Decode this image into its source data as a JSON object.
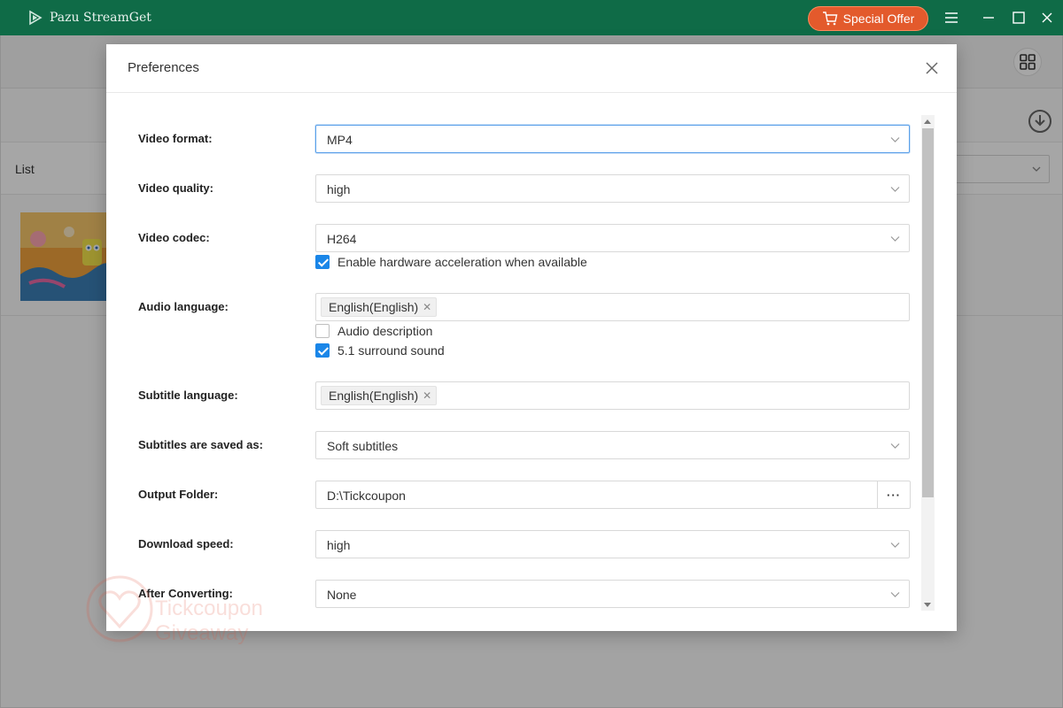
{
  "titlebar": {
    "app_name": "Pazu StreamGet",
    "special_offer_label": "Special Offer",
    "accent_color": "#0f6b47",
    "offer_color": "#e35a2c"
  },
  "background": {
    "list_label": "List"
  },
  "watermark": {
    "line1": "Tickcoupon",
    "line2": "Giveaway"
  },
  "dialog": {
    "title": "Preferences",
    "fields": {
      "video_format": {
        "label": "Video format:",
        "value": "MP4"
      },
      "video_quality": {
        "label": "Video quality:",
        "value": "high"
      },
      "video_codec": {
        "label": "Video codec:",
        "value": "H264"
      },
      "hw_accel": {
        "label": "Enable hardware acceleration when available",
        "checked": true
      },
      "audio_language": {
        "label": "Audio language:",
        "tags": [
          "English(English)"
        ]
      },
      "audio_description": {
        "label": "Audio description",
        "checked": false
      },
      "surround": {
        "label": "5.1 surround sound",
        "checked": true
      },
      "subtitle_language": {
        "label": "Subtitle language:",
        "tags": [
          "English(English)"
        ]
      },
      "subtitles_saved_as": {
        "label": "Subtitles are saved as:",
        "value": "Soft subtitles"
      },
      "output_folder": {
        "label": "Output Folder:",
        "value": "D:\\Tickcoupon",
        "browse_label": "···"
      },
      "download_speed": {
        "label": "Download speed:",
        "value": "high"
      },
      "after_converting": {
        "label": "After Converting:",
        "value": "None"
      }
    },
    "checkbox_color": "#1a86e8"
  }
}
